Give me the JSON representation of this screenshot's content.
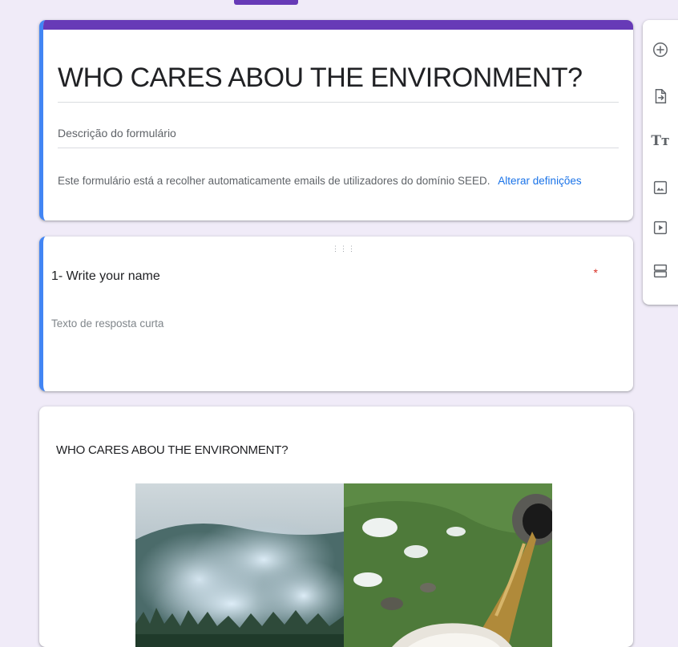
{
  "form": {
    "title": "WHO CARES ABOU THE ENVIRONMENT?",
    "description_placeholder": "Descrição do formulário",
    "email_notice": "Este formulário está a recolher automaticamente emails de utilizadores do domínio SEED.",
    "email_settings_link": "Alterar definições"
  },
  "question": {
    "drag_handle": "⋮⋮⋮",
    "title": "1- Write your name",
    "required_marker": "*",
    "answer_placeholder": "Texto de resposta curta"
  },
  "section": {
    "title": "WHO CARES ABOU THE ENVIRONMENT?",
    "image_left_icon": "forest-fire-smoke-image",
    "image_right_icon": "sewage-pipe-discharge-image"
  },
  "toolbar": {
    "items": [
      {
        "icon": "add-question-icon"
      },
      {
        "icon": "import-questions-icon"
      },
      {
        "icon": "add-title-icon",
        "label": "Tт"
      },
      {
        "icon": "add-image-icon"
      },
      {
        "icon": "add-video-icon"
      },
      {
        "icon": "add-section-icon"
      }
    ]
  },
  "colors": {
    "accent": "#673ab7",
    "focus": "#4285f4",
    "background": "#f0ebf8",
    "link": "#1a73e8",
    "required": "#d93025"
  }
}
